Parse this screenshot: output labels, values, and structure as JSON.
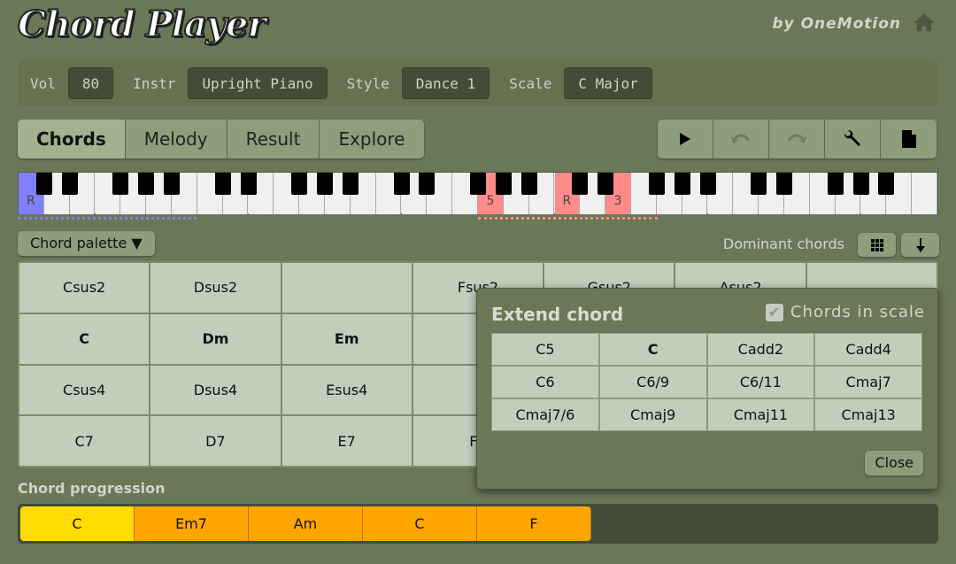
{
  "header": {
    "logo": "Chord Player",
    "byline": "by OneMotion",
    "home_icon": "home-icon"
  },
  "settings": {
    "vol_label": "Vol",
    "vol": "80",
    "instr_label": "Instr",
    "instr": "Upright Piano",
    "style_label": "Style",
    "style": "Dance 1",
    "scale_label": "Scale",
    "scale": "C Major"
  },
  "tabs": [
    {
      "label": "Chords",
      "active": true
    },
    {
      "label": "Melody"
    },
    {
      "label": "Result"
    },
    {
      "label": "Explore"
    }
  ],
  "toolbar": [
    {
      "icon": "play-icon"
    },
    {
      "icon": "undo-icon",
      "disabled": true
    },
    {
      "icon": "redo-icon",
      "disabled": true
    },
    {
      "icon": "wrench-icon"
    },
    {
      "icon": "document-icon"
    }
  ],
  "piano": {
    "white_keys": 36,
    "highlights": [
      {
        "key": 0,
        "label": "R",
        "color": "#8080ff"
      },
      {
        "key": 18,
        "label": "5",
        "color": "#ff8a8a"
      },
      {
        "key": 21,
        "label": "R",
        "color": "#ff8a8a"
      },
      {
        "key": 23,
        "label": "3",
        "color": "#ff8a8a"
      }
    ]
  },
  "palette": {
    "button": "Chord palette ▼",
    "mode": "Dominant chords",
    "rows": [
      [
        "Csus2",
        "Dsus2",
        "",
        "Fsus2",
        "Gsus2",
        "Asus2",
        ""
      ],
      [
        "C",
        "Dm",
        "Em",
        "",
        "",
        "",
        ""
      ],
      [
        "Csus4",
        "Dsus4",
        "Esus4",
        "",
        "",
        "",
        ""
      ],
      [
        "C7",
        "D7",
        "E7",
        "F7",
        "",
        "",
        ""
      ]
    ],
    "bold_row": 1
  },
  "progression": {
    "label": "Chord progression",
    "chords": [
      "C",
      "Em7",
      "Am",
      "C",
      "F"
    ],
    "active_index": 0
  },
  "popup": {
    "title": "Extend chord",
    "checkbox_label": "Chords in scale",
    "checked": true,
    "chords": [
      "C5",
      "C",
      "Cadd2",
      "Cadd4",
      "C6",
      "C6/9",
      "C6/11",
      "Cmaj7",
      "Cmaj7/6",
      "Cmaj9",
      "Cmaj11",
      "Cmaj13"
    ],
    "bold": "C",
    "close": "Close"
  },
  "colors": {
    "background": "#6b7857",
    "button": "#8e9e7c",
    "cell": "#bfcfbb",
    "progression_active": "#ffdc00",
    "progression": "#ffa500"
  }
}
